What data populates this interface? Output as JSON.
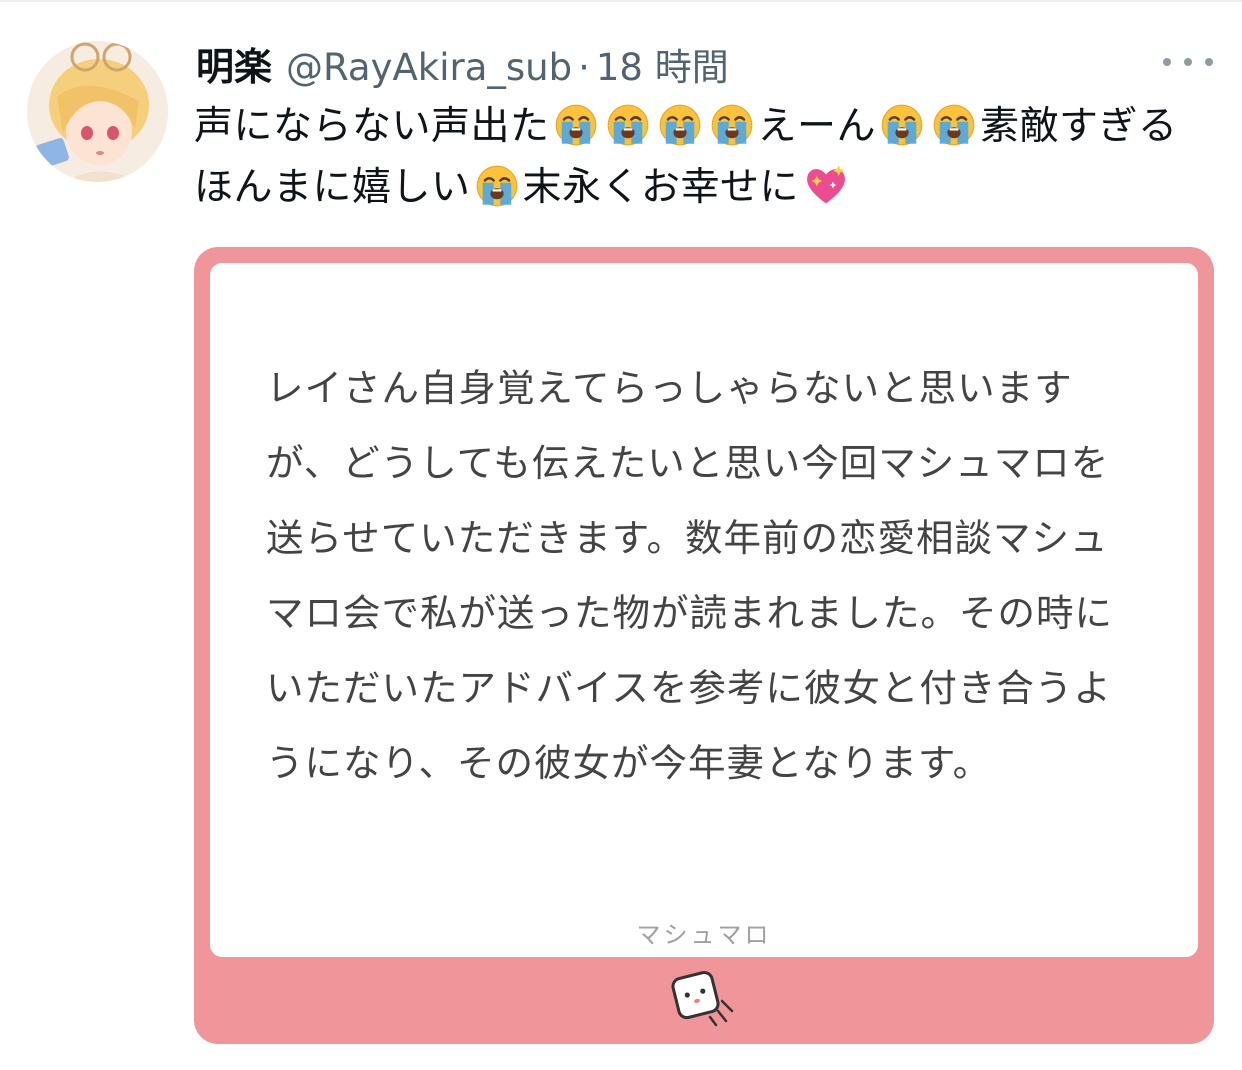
{
  "tweet": {
    "display_name": "明楽",
    "handle": "@RayAkira_sub",
    "separator": "·",
    "time": "18 時間",
    "text_part1": "声にならない声出た",
    "text_part2": "えーん",
    "text_part3": "素敵すぎるほんまに嬉しい",
    "text_part4": "末永くお幸せに"
  },
  "card": {
    "message": "レイさん自身覚えてらっしゃらないと思いますが、どうしても伝えたいと思い今回マシュマロを送らせていただきます。数年前の恋愛相談マシュマロ会で私が送った物が読まれました。その時にいただいたアドバイスを参考に彼女と付き合うようになり、その彼女が今年妻となります。",
    "brand": "マシュマロ"
  },
  "icons": {
    "avatar": "avatar-image",
    "crying_emoji": "loudly-crying-face-icon",
    "heart_emoji": "sparkling-heart-icon",
    "more": "more-dots-icon",
    "mascot": "marshmallow-mascot-icon"
  },
  "colors": {
    "card_background": "#f0959a",
    "secondary_text": "#536471",
    "card_text": "#444444"
  }
}
